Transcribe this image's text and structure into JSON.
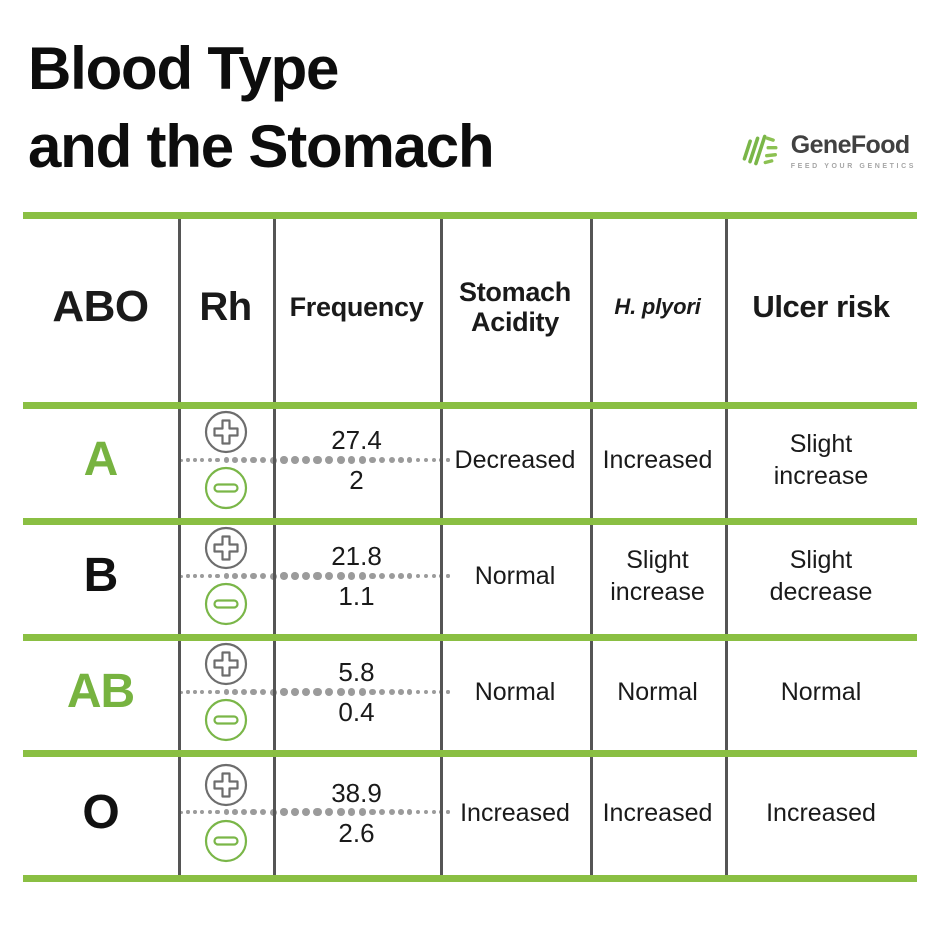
{
  "header": {
    "title": "Blood Type\nand the Stomach",
    "logo": {
      "wordmark": "GeneFood",
      "tagline": "FEED YOUR GENETICS",
      "mark_name": "genefood-logo-mark"
    }
  },
  "colors": {
    "accent_green": "#8abf43",
    "label_green": "#77b340",
    "divider_gray": "#555555",
    "text_dark": "#1a1a1a",
    "icon_gray": "#6d6d6d",
    "dot_gray": "#9b9b9b"
  },
  "table": {
    "columns": [
      {
        "key": "abo",
        "label": "ABO"
      },
      {
        "key": "rh",
        "label": "Rh"
      },
      {
        "key": "freq",
        "label": "Frequency"
      },
      {
        "key": "acidity",
        "label": "Stomach\nAcidity"
      },
      {
        "key": "hp",
        "label": "H. plyori"
      },
      {
        "key": "ulcer",
        "label": "Ulcer risk"
      }
    ],
    "rh_icons": {
      "positive": "rh-positive-icon",
      "negative": "rh-negative-icon"
    },
    "rows": [
      {
        "abo": "A",
        "abo_color": "green",
        "freq_positive": "27.4",
        "freq_negative": "2",
        "acidity": "Decreased",
        "hp": "Increased",
        "ulcer": "Slight\nincrease"
      },
      {
        "abo": "B",
        "abo_color": "dark",
        "freq_positive": "21.8",
        "freq_negative": "1.1",
        "acidity": "Normal",
        "hp": "Slight\nincrease",
        "ulcer": "Slight\ndecrease"
      },
      {
        "abo": "AB",
        "abo_color": "green",
        "freq_positive": "5.8",
        "freq_negative": "0.4",
        "acidity": "Normal",
        "hp": "Normal",
        "ulcer": "Normal"
      },
      {
        "abo": "O",
        "abo_color": "dark",
        "freq_positive": "38.9",
        "freq_negative": "2.6",
        "acidity": "Increased",
        "hp": "Increased",
        "ulcer": "Increased"
      }
    ]
  }
}
